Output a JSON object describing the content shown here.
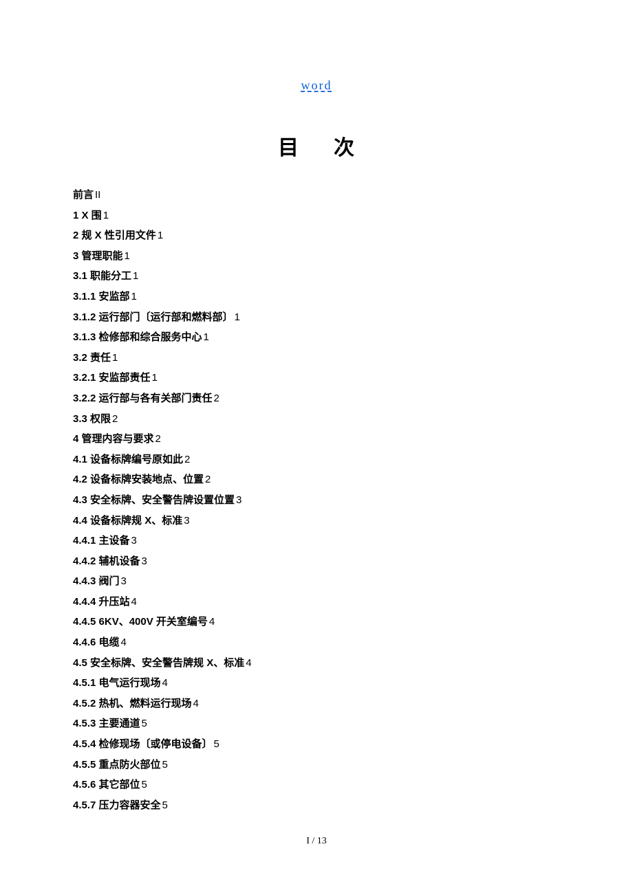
{
  "header": {
    "link_text": "word"
  },
  "title": {
    "char1": "目",
    "char2": "次"
  },
  "toc": [
    {
      "label": "前言",
      "page": "II"
    },
    {
      "label": "1 X 围",
      "page": "1"
    },
    {
      "label": "2 规 X 性引用文件",
      "page": "1"
    },
    {
      "label": "3 管理职能",
      "page": "1"
    },
    {
      "label": "3.1 职能分工",
      "page": "1"
    },
    {
      "label": "3.1.1 安监部",
      "page": "1"
    },
    {
      "label": "3.1.2 运行部门〔运行部和燃料部〕",
      "page": "1"
    },
    {
      "label": "3.1.3 检修部和综合服务中心",
      "page": "1"
    },
    {
      "label": "3.2 责任",
      "page": "1"
    },
    {
      "label": "3.2.1  安监部责任",
      "page": "1"
    },
    {
      "label": "3.2.2  运行部与各有关部门责任",
      "page": "2"
    },
    {
      "label": "3.3 权限",
      "page": "2"
    },
    {
      "label": "4 管理内容与要求",
      "page": "2"
    },
    {
      "label": "4.1 设备标牌编号原如此",
      "page": "2"
    },
    {
      "label": "4.2 设备标牌安装地点、位置",
      "page": "2"
    },
    {
      "label": "4.3 安全标牌、安全警告牌设置位置",
      "page": "3"
    },
    {
      "label": "4.4 设备标牌规 X、标准",
      "page": "3"
    },
    {
      "label": "4.4.1 主设备",
      "page": "3"
    },
    {
      "label": "4.4.2 辅机设备",
      "page": "3"
    },
    {
      "label": "4.4.3 阀门",
      "page": "3"
    },
    {
      "label": "4.4.4 升压站",
      "page": "4"
    },
    {
      "label": "4.4.5 6KV、400V 开关室编号",
      "page": "4"
    },
    {
      "label": "4.4.6 电缆",
      "page": "4"
    },
    {
      "label": "4.5 安全标牌、安全警告牌规 X、标准",
      "page": "4"
    },
    {
      "label": "4.5.1 电气运行现场",
      "page": "4"
    },
    {
      "label": "4.5.2 热机、燃料运行现场",
      "page": "4"
    },
    {
      "label": "4.5.3 主要通道",
      "page": "5"
    },
    {
      "label": "4.5.4 检修现场〔或停电设备〕",
      "page": "5"
    },
    {
      "label": "4.5.5 重点防火部位",
      "page": "5"
    },
    {
      "label": "4.5.6 其它部位",
      "page": "5"
    },
    {
      "label": "4.5.7 压力容器安全",
      "page": "5"
    }
  ],
  "footer": {
    "page_indicator": "I / 13"
  }
}
